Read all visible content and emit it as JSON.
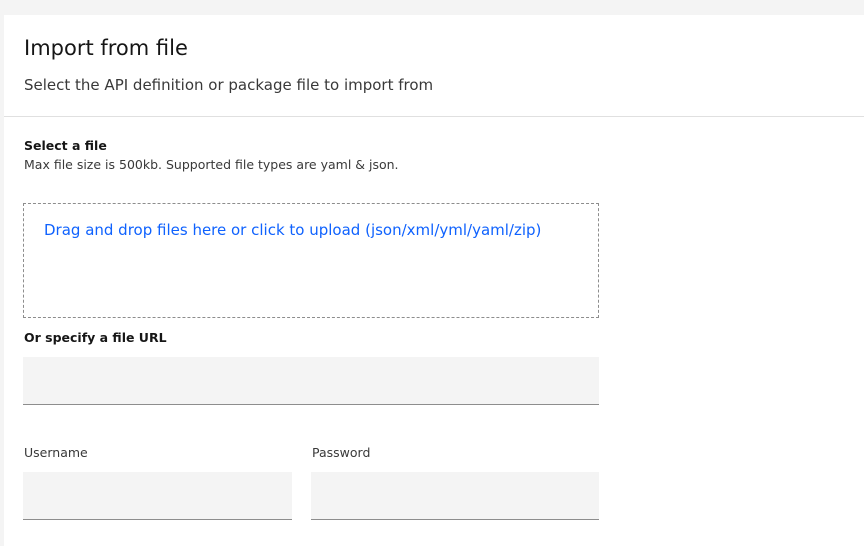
{
  "header": {
    "title": "Import from file",
    "subtitle": "Select the API definition or package file to import from"
  },
  "file_select": {
    "label": "Select a file",
    "help_text": "Max file size is 500kb. Supported file types are yaml & json.",
    "dropzone_text": "Drag and drop files here or click to upload (json/xml/yml/yaml/zip)"
  },
  "url_field": {
    "label": "Or specify a file URL",
    "value": ""
  },
  "credentials": {
    "username_label": "Username",
    "username_value": "",
    "password_label": "Password",
    "password_value": ""
  },
  "colors": {
    "link": "#0f62fe",
    "field_background": "#f4f4f4",
    "divider": "#e0e0e0"
  }
}
